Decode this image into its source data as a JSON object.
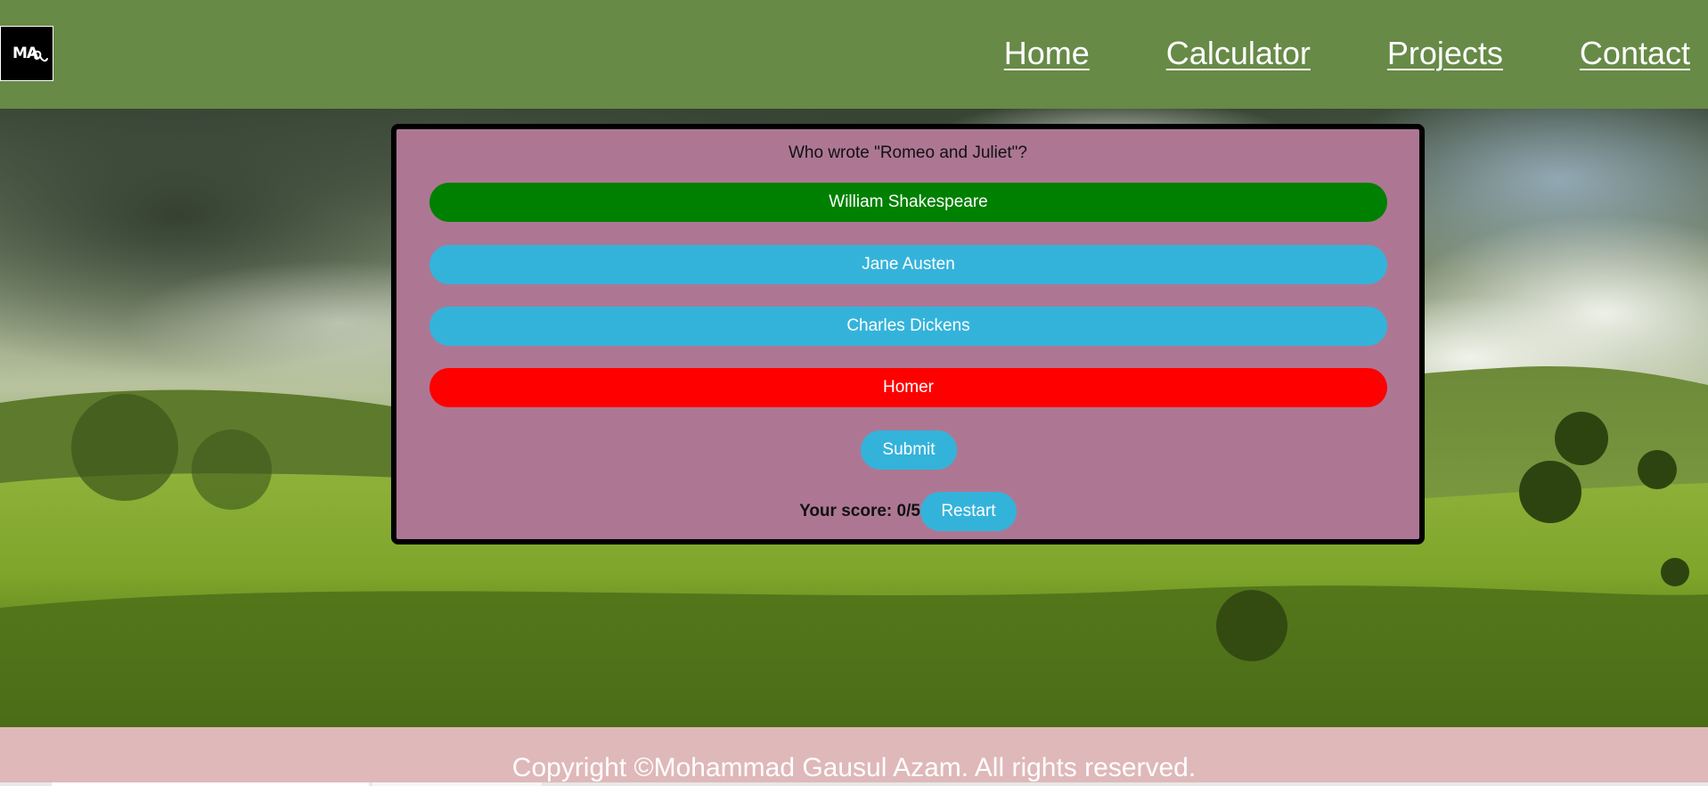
{
  "header": {
    "logo_text": "MA",
    "nav": [
      "Home",
      "Calculator",
      "Projects",
      "Contact"
    ]
  },
  "quiz": {
    "question": "Who wrote \"Romeo and Juliet\"?",
    "answers": [
      {
        "label": "William Shakespeare",
        "state": "correct",
        "color": "#008000"
      },
      {
        "label": "Jane Austen",
        "state": "neutral",
        "color": "#34b3da"
      },
      {
        "label": "Charles Dickens",
        "state": "neutral",
        "color": "#34b3da"
      },
      {
        "label": "Homer",
        "state": "incorrect",
        "color": "#ff0000"
      }
    ],
    "submit_label": "Submit",
    "score_text": "Your score: 0/5",
    "restart_label": "Restart"
  },
  "footer": {
    "copyright": "Copyright ©Mohammad Gausul Azam. All rights reserved."
  },
  "colors": {
    "header_bg": "#678a47",
    "quiz_bg": "#ad7794",
    "button_blue": "#34b3da",
    "footer_bg": "#dfb8b9"
  }
}
